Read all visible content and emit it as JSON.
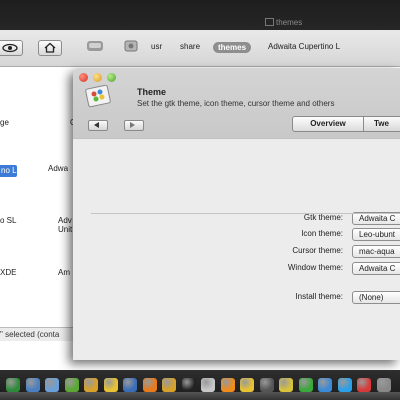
{
  "topbar": {
    "title": "themes"
  },
  "file_manager": {
    "breadcrumbs": [
      "usr",
      "share"
    ],
    "active_crumb": "themes",
    "next_crumb": "Adwaita Cupertino L",
    "items": [
      {
        "label": "ge"
      },
      {
        "label": "C"
      },
      {
        "label": "no L"
      },
      {
        "label": "Adwa"
      },
      {
        "label": "o SL"
      },
      {
        "label": "Adv"
      },
      {
        "label": "Unit"
      },
      {
        "label": "XDE"
      },
      {
        "label": "Am"
      }
    ],
    "status": "\" selected (conta"
  },
  "dialog": {
    "title": "Theme",
    "subtitle": "Set the gtk theme, icon theme, cursor theme and others",
    "tabs": {
      "overview": "Overview",
      "tweaks": "Twe"
    },
    "fields": [
      {
        "label": "Gtk theme:",
        "value": "Adwaita C"
      },
      {
        "label": "Icon theme:",
        "value": "Leo-ubunt"
      },
      {
        "label": "Cursor theme:",
        "value": "mac-aqua"
      },
      {
        "label": "Window theme:",
        "value": "Adwaita C"
      }
    ],
    "install": {
      "label": "Install theme:",
      "value": "(None)"
    }
  },
  "dock": {
    "icons": [
      {
        "name": "ubuntu-icon",
        "color": "#2e8b3a"
      },
      {
        "name": "image-icon",
        "color": "#4a7fc1"
      },
      {
        "name": "chart-icon",
        "color": "#6aa0d8"
      },
      {
        "name": "pidgin-icon",
        "color": "#5aa832"
      },
      {
        "name": "gear-icon",
        "color": "#d8a12a"
      },
      {
        "name": "warning-icon",
        "color": "#e8c232"
      },
      {
        "name": "app-icon",
        "color": "#3a6db8"
      },
      {
        "name": "wifi-icon",
        "color": "#e87a1a"
      },
      {
        "name": "grid-icon",
        "color": "#d8a12a"
      },
      {
        "name": "terminal-icon",
        "color": "#222222"
      },
      {
        "name": "star-icon",
        "color": "#c8c8c8"
      },
      {
        "name": "vlc-icon",
        "color": "#f08c1a"
      },
      {
        "name": "lock-icon",
        "color": "#e8c232"
      },
      {
        "name": "film-icon",
        "color": "#555555"
      },
      {
        "name": "um-icon",
        "color": "#d8c23a"
      },
      {
        "name": "pause-icon",
        "color": "#3aa83a"
      },
      {
        "name": "chat-icon",
        "color": "#3a8ad8"
      },
      {
        "name": "skype-icon",
        "color": "#2aa0e8"
      },
      {
        "name": "record-icon",
        "color": "#d83a3a"
      },
      {
        "name": "trash-icon",
        "color": "#888888"
      }
    ]
  }
}
